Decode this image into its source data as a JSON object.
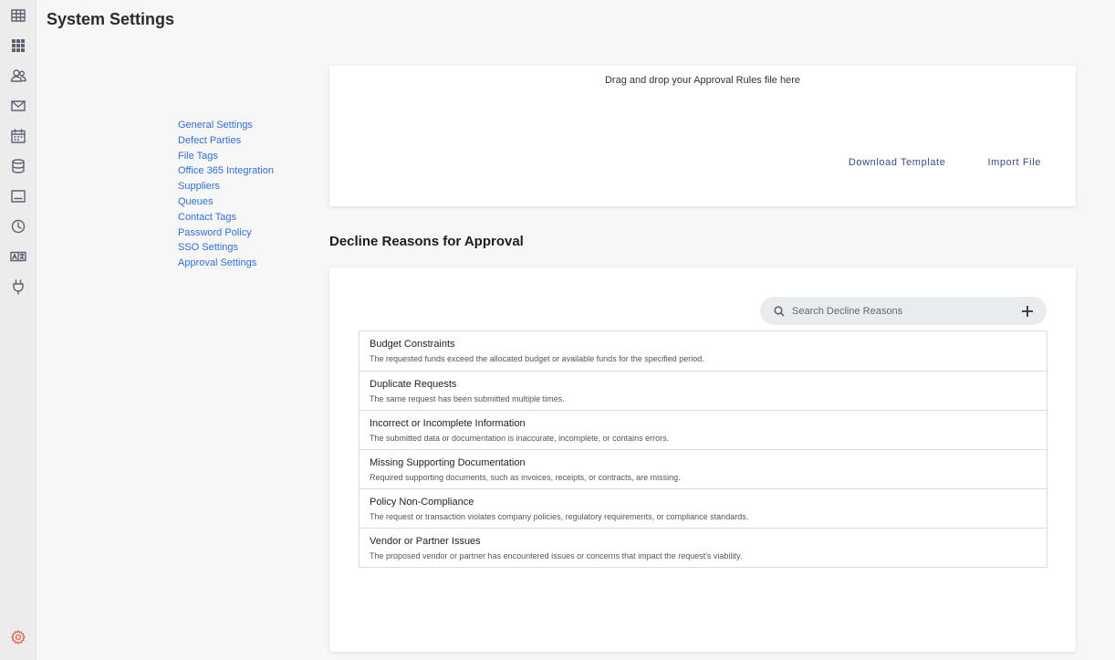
{
  "header": {
    "title": "System Settings"
  },
  "rail": {
    "icons": [
      "table-icon",
      "grid-icon",
      "users-icon",
      "mail-icon",
      "calendar-icon",
      "database-icon",
      "terminal-icon",
      "clock-icon",
      "translate-icon",
      "plug-icon"
    ],
    "bottom_icon": "gear-icon",
    "active_color": "#e06a4f"
  },
  "settings_nav": {
    "items": [
      {
        "label": "General Settings"
      },
      {
        "label": "Defect Parties"
      },
      {
        "label": "File Tags"
      },
      {
        "label": "Office 365 Integration"
      },
      {
        "label": "Suppliers"
      },
      {
        "label": "Queues"
      },
      {
        "label": "Contact Tags"
      },
      {
        "label": "Password Policy"
      },
      {
        "label": "SSO Settings"
      },
      {
        "label": "Approval Settings"
      }
    ]
  },
  "upload": {
    "drop_text": "Drag and drop your Approval Rules file here",
    "download_label": "Download Template",
    "import_label": "Import File"
  },
  "decline_reasons": {
    "title": "Decline Reasons for Approval",
    "search_placeholder": "Search Decline Reasons",
    "items": [
      {
        "title": "Budget Constraints",
        "description": "The requested funds exceed the allocated budget or available funds for the specified period."
      },
      {
        "title": "Duplicate Requests",
        "description": "The same request has been submitted multiple times."
      },
      {
        "title": "Incorrect or Incomplete Information",
        "description": "The submitted data or documentation is inaccurate, incomplete, or contains errors."
      },
      {
        "title": "Missing Supporting Documentation",
        "description": "Required supporting documents, such as invoices, receipts, or contracts, are missing."
      },
      {
        "title": "Policy Non-Compliance",
        "description": "The request or transaction violates company policies, regulatory requirements, or compliance standards."
      },
      {
        "title": "Vendor or Partner Issues",
        "description": "The proposed vendor or partner has encountered issues or concerns that impact the request's viability."
      }
    ]
  }
}
